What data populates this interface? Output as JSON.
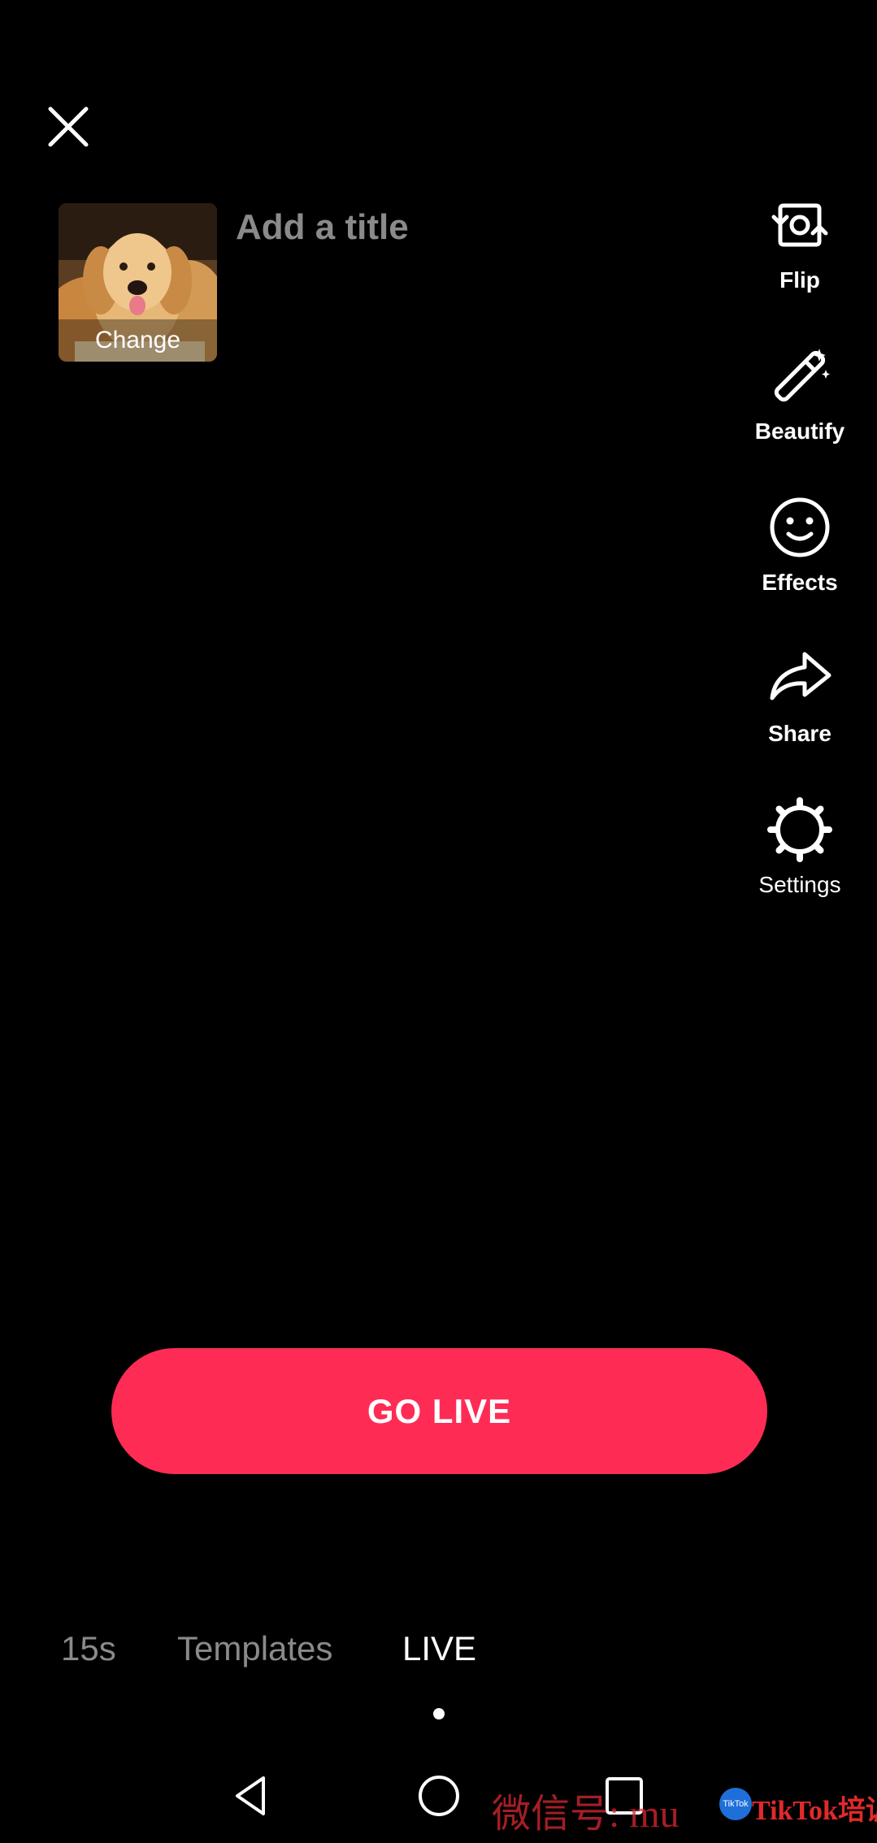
{
  "close": {
    "icon": "close-icon"
  },
  "cover": {
    "change_label": "Change",
    "image": "golden-retriever-photo"
  },
  "title": {
    "placeholder": "Add a title",
    "value": ""
  },
  "tools": [
    {
      "label": "Flip",
      "icon": "flip-camera-icon"
    },
    {
      "label": "Beautify",
      "icon": "magic-wand-icon"
    },
    {
      "label": "Effects",
      "icon": "smiley-face-icon"
    },
    {
      "label": "Share",
      "icon": "share-arrow-icon"
    },
    {
      "label": "Settings",
      "icon": "gear-icon"
    }
  ],
  "go_live": {
    "label": "GO LIVE",
    "color": "#fe2c55"
  },
  "modes": [
    {
      "label": "15s",
      "active": false
    },
    {
      "label": "Templates",
      "active": false
    },
    {
      "label": "LIVE",
      "active": true
    }
  ],
  "nav": {
    "back_icon": "back-triangle-icon",
    "home_icon": "home-circle-icon",
    "recent_icon": "recent-square-icon"
  },
  "watermark": {
    "text": "微信号: mu",
    "logo_text": "TikTok",
    "brand": "TikTok培训"
  }
}
